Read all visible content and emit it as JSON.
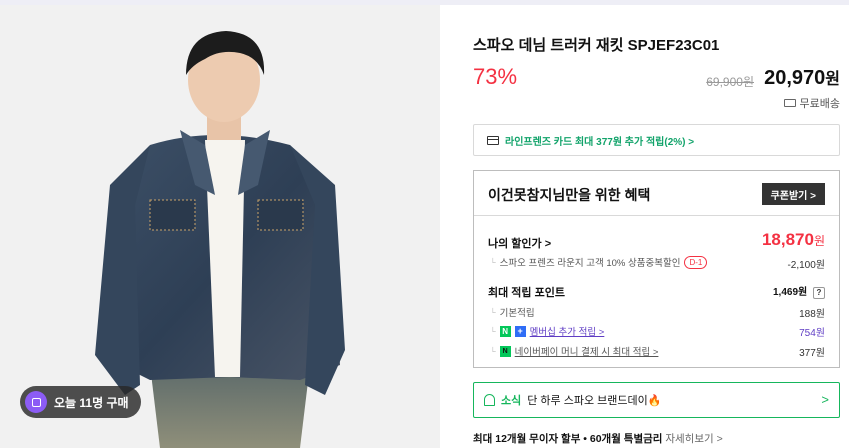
{
  "product": {
    "title": "스파오 데님 트러커 재킷 SPJEF23C01",
    "discount_rate": "73%",
    "original_price": "69,900원",
    "sale_price": "20,970",
    "sale_unit": "원",
    "shipping": "무료배송"
  },
  "photo": {
    "purchase_badge": "오늘 11명 구매"
  },
  "card_promo": {
    "text": "라인프렌즈 카드 최대 377원 추가 적립(2%) >"
  },
  "benefit": {
    "heading": "이건못참지님만을 위한 혜택",
    "coupon_button": "쿠폰받기 >",
    "my_discount_label": "나의 할인가 >",
    "my_discount_value": "18,870",
    "my_discount_unit": "원",
    "lounge_label": "스파오 프렌즈 라운지 고객 10% 상품중복할인",
    "lounge_badge": "D-1",
    "lounge_value": "-2,100원",
    "points_label": "최대 적립 포인트",
    "points_value": "1,469원",
    "points_help": "?",
    "basic_label": "기본적립",
    "basic_value": "188원",
    "member_label": "멤버십 추가 적립 >",
    "member_value": "754원",
    "npay_label": "네이버페이 머니 결제 시 최대 적립 >",
    "npay_value": "377원"
  },
  "brand_day": {
    "prefix": "소식",
    "text": "단 하루 스파오 브랜드데이🔥",
    "arrow": ">"
  },
  "installment": {
    "text": "최대 12개월 무이자 할부 • 60개월 특별금리",
    "more": "자세히보기 >"
  },
  "colors": {
    "accent_red": "#f43142",
    "accent_green": "#16b65c",
    "badge_purple": "#8c5cf5"
  }
}
